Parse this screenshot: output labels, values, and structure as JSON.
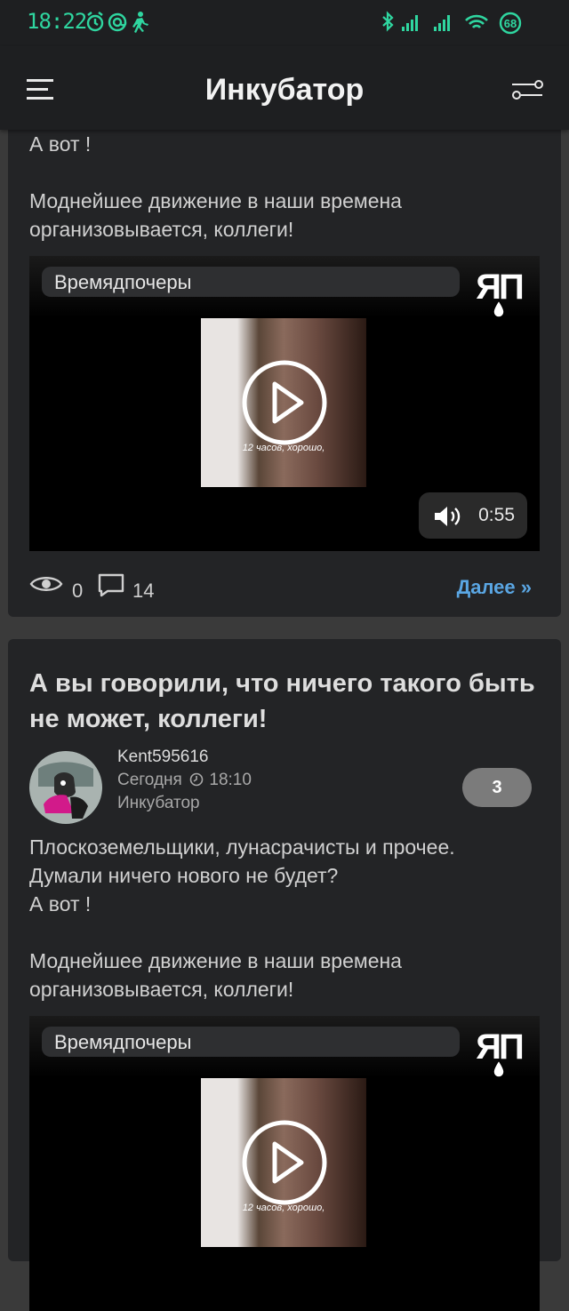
{
  "status_bar": {
    "time": "18:22",
    "battery": "68",
    "icons_left": [
      "alarm-icon",
      "at-icon",
      "walk-icon"
    ],
    "icons_right": [
      "bluetooth-icon",
      "signal-icon",
      "signal-icon",
      "wifi-icon",
      "battery-icon"
    ]
  },
  "app_bar": {
    "title": "Инкубатор",
    "menu_icon": "hamburger-menu-icon",
    "filter_icon": "filter-sliders-icon"
  },
  "posts": [
    {
      "body_lines": [
        "А вот !",
        "",
        "Моднейшее движение в наши времена",
        "организовывается, коллеги!"
      ],
      "video": {
        "title": "Времядпочеры",
        "logo_text": "ЯП",
        "thumb_caption": "12 часов, хорошо,",
        "duration": "0:55"
      },
      "views": "0",
      "comments": "14",
      "more_label": "Далее »"
    },
    {
      "title": "А вы говорили, что ничего такого быть не может, коллеги!",
      "author": "Kent595616",
      "date_prefix": "Сегодня",
      "time": "18:10",
      "category": "Инкубатор",
      "rating": "3",
      "body_lines": [
        "Плоскоземельщики, лунасрачисты и прочее.",
        "Думали ничего нового не будет?",
        "А вот !",
        "",
        "Моднейшее движение в наши времена",
        "организовывается, коллеги!"
      ],
      "video": {
        "title": "Времядпочеры",
        "logo_text": "ЯП",
        "thumb_caption": "12 часов, хорошо,"
      }
    }
  ],
  "colors": {
    "status_accent": "#2fd6a0",
    "link": "#5aa6e3",
    "card_bg": "#232426",
    "page_bg": "#3a3a3a"
  }
}
